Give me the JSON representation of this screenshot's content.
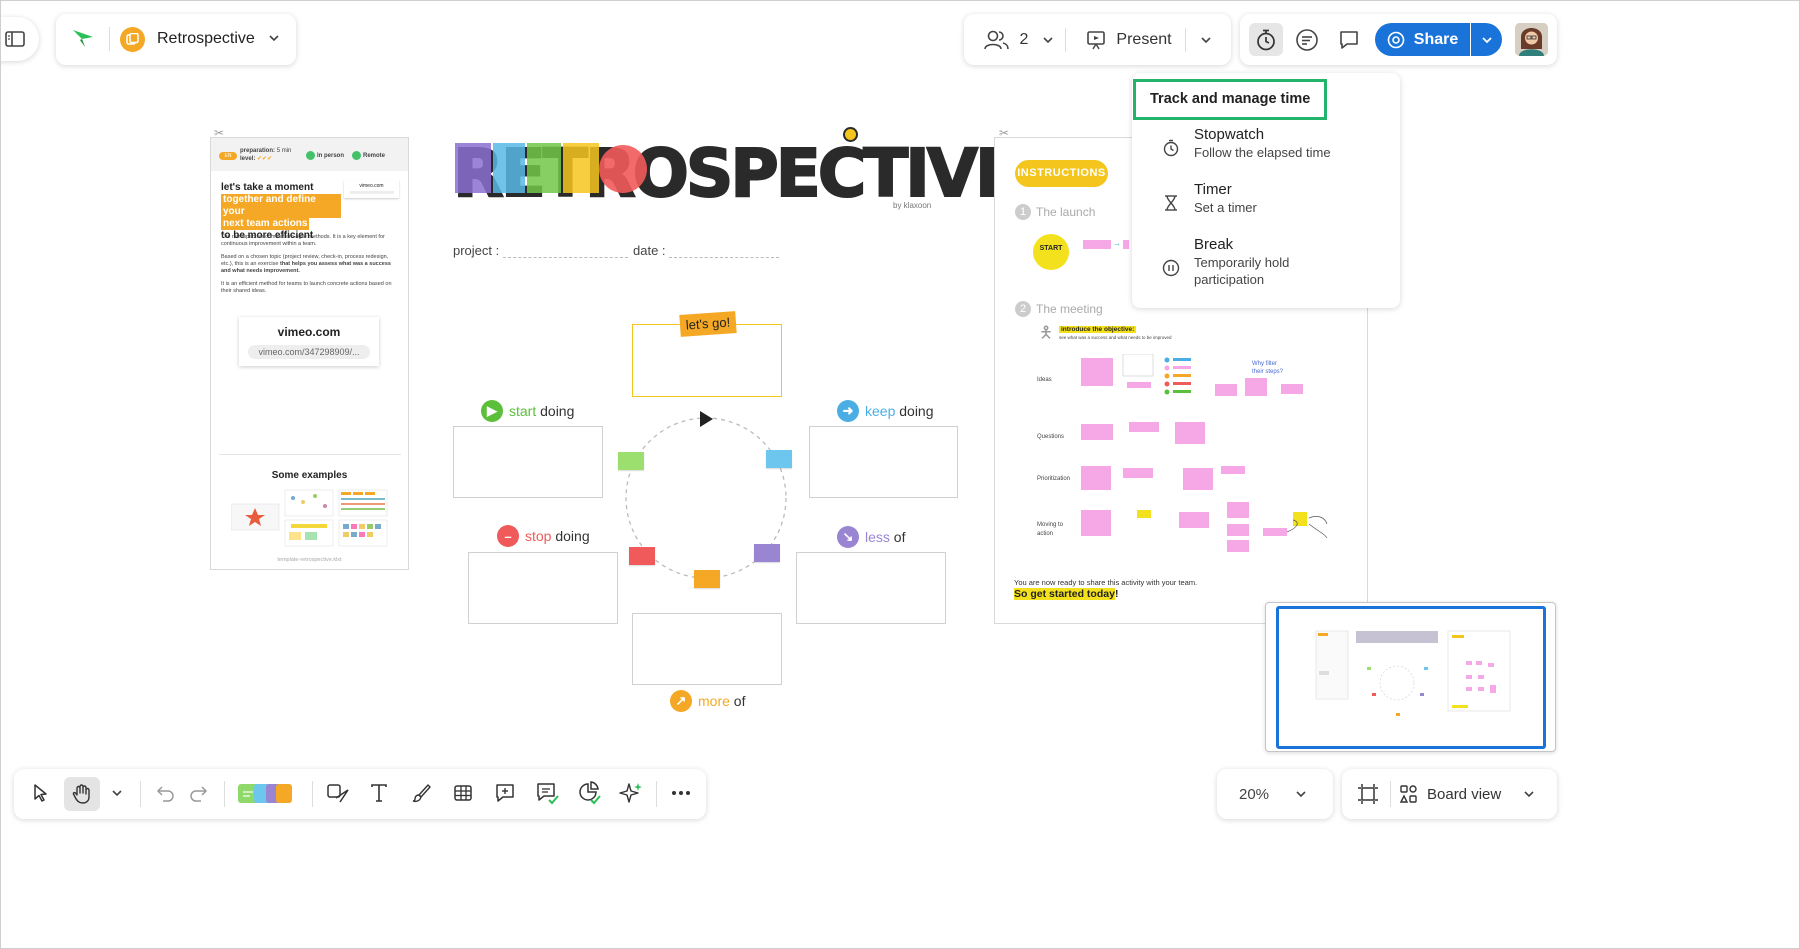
{
  "app": {
    "board_title": "Retrospective"
  },
  "colors": {
    "brand": "#f4a825",
    "share": "#1a73d9",
    "menu_highlight": "#23b36b"
  },
  "header": {
    "participants_count": "2",
    "present_label": "Present",
    "share_label": "Share"
  },
  "timer_menu": {
    "title": "Track and manage time",
    "items": [
      {
        "icon": "stopwatch-icon",
        "label": "Stopwatch",
        "description": "Follow the elapsed time"
      },
      {
        "icon": "hourglass-icon",
        "label": "Timer",
        "description": "Set a timer"
      },
      {
        "icon": "pause-icon",
        "label": "Break",
        "description": "Temporarily hold participation"
      }
    ]
  },
  "board": {
    "left_card": {
      "badge": "EN",
      "preparation": "preparation:",
      "preparation_val": "5 min",
      "level": "level:",
      "in_person": "In person",
      "remote": "Remote",
      "heading_1": "let's take a moment",
      "heading_2": "together and define your",
      "heading_3": "next team actions",
      "heading_4": "to be more efficient",
      "mini_vimeo": "vimeo.com",
      "para_1": "The retrospective comes from agile methods. It is a key element for continuous improvement within a team.",
      "para_2a": "Based on a chosen topic (project review, check-in, process redesign, etc.), this is an exercise ",
      "para_2b": "that helps you assess what was a success and what needs improvement.",
      "para_3": "It is an efficient method for teams to launch concrete actions based on their shared ideas.",
      "video_title": "vimeo.com",
      "video_url": "vimeo.com/347298909/...",
      "examples_title": "Some examples",
      "footer": "template-retrospective.klxt"
    },
    "center": {
      "logo": "RETROSPECTIVE",
      "logo_by": "by klaxoon",
      "project_label": "project :",
      "date_label": "date :",
      "lets_go": "let's go!",
      "start_a": "start",
      "start_b": "doing",
      "keep_a": "keep",
      "keep_b": "doing",
      "stop_a": "stop",
      "stop_b": "doing",
      "less_a": "less",
      "less_b": "of",
      "more_a": "more",
      "more_b": "of"
    },
    "instructions": {
      "badge": "INSTRUCTIONS",
      "step1": "The launch",
      "step2": "The meeting",
      "start_sticker": "START",
      "objective": "introduce the objective:",
      "objective_sub": "see what was a success and what needs to be improved",
      "rows": [
        "Ideas",
        "Questions",
        "Prioritization",
        "Moving to action"
      ],
      "question_1": "Why filter",
      "question_2": "their steps?",
      "ready": "You are now ready to share this activity with your team.",
      "get_started": "So get started today",
      "bang": "!"
    }
  },
  "bottom": {
    "zoom": "20%",
    "board_view": "Board view"
  }
}
